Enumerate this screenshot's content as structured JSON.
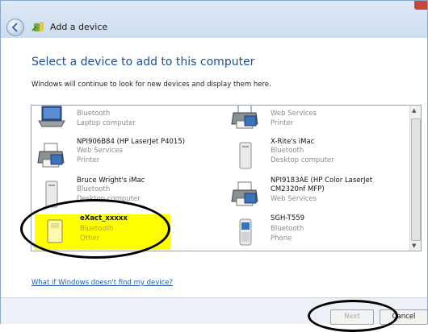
{
  "window": {
    "title": "Add a device",
    "heading": "Select a device to add to this computer",
    "subtext": "Windows will continue to look for new devices and display them here."
  },
  "devices": [
    {
      "name": "",
      "line2": "Bluetooth",
      "line3": "Laptop computer",
      "icon": "laptop-icon"
    },
    {
      "name": "",
      "line2": "Web Services",
      "line3": "Printer",
      "icon": "printer-icon"
    },
    {
      "name": "NPI906B84 (HP LaserJet P4015)",
      "line2": "Web Services",
      "line3": "Printer",
      "icon": "printer-icon"
    },
    {
      "name": "X-Rite's iMac",
      "line2": "Bluetooth",
      "line3": "Desktop computer",
      "icon": "desktop-tower-icon"
    },
    {
      "name": "Bruce Wright's iMac",
      "line2": "Bluetooth",
      "line3": "Desktop computer",
      "icon": "desktop-tower-icon"
    },
    {
      "name": "NPI9183AE (HP Color LaserJet CM2320nf MFP)",
      "line2": "Web Services",
      "icon": "printer-icon"
    },
    {
      "name": "eXact_xxxxx",
      "line2": "Bluetooth",
      "line3": "Other",
      "icon": "device-icon",
      "selected": true
    },
    {
      "name": "SGH-T559",
      "line2": "Bluetooth",
      "line3": "Phone",
      "icon": "phone-icon"
    }
  ],
  "help_link": "What if Windows doesn't find my device?",
  "buttons": {
    "next": "Next",
    "cancel": "Cancel"
  }
}
